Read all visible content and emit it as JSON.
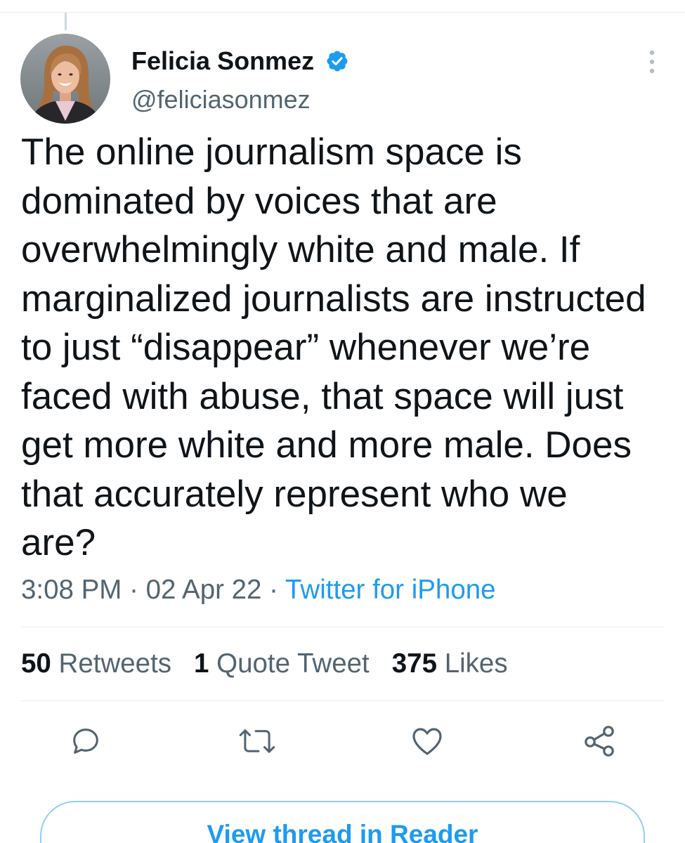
{
  "tweet": {
    "author": {
      "name": "Felicia Sonmez",
      "handle": "@feliciasonmez",
      "verified": true,
      "verified_icon": "verified-badge-icon",
      "avatar_icon": "avatar-photo"
    },
    "more_icon": "more-vertical-icon",
    "body": "The online journalism space is\ndominated by voices that are\noverwhelmingly white and male. If\nmarginalized journalists are instructed\nto just “disappear” whenever we’re\nfaced with abuse, that space will just\nget more white and more male. Does\nthat accurately represent who we\nare?",
    "meta": {
      "time": "3:08 PM",
      "separator": "·",
      "date": "02 Apr 22",
      "source": "Twitter for iPhone"
    },
    "stats": [
      {
        "count": "50",
        "label": "Retweets"
      },
      {
        "count": "1",
        "label": "Quote Tweet"
      },
      {
        "count": "375",
        "label": "Likes"
      }
    ],
    "actions": [
      {
        "icon": "reply-icon"
      },
      {
        "icon": "retweet-icon"
      },
      {
        "icon": "like-icon"
      },
      {
        "icon": "share-icon"
      }
    ]
  },
  "reader_button": {
    "label": "View thread in Reader"
  },
  "colors": {
    "accent": "#1d9bf0",
    "text": "#0f1419",
    "secondary_text": "#536471",
    "divider": "#e6ecf0",
    "button_border": "#93cdf5"
  }
}
